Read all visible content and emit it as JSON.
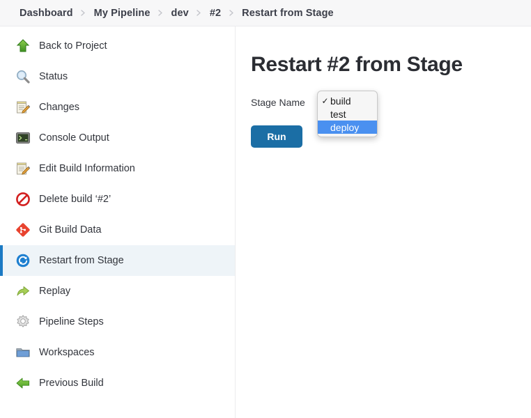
{
  "breadcrumb": {
    "items": [
      {
        "label": "Dashboard"
      },
      {
        "label": "My Pipeline"
      },
      {
        "label": "dev"
      },
      {
        "label": "#2"
      },
      {
        "label": "Restart from Stage"
      }
    ],
    "separator_icon": "chevron-right-icon"
  },
  "sidebar": {
    "items": [
      {
        "label": "Back to Project",
        "icon": "green-up-arrow-icon",
        "active": false
      },
      {
        "label": "Status",
        "icon": "magnifier-icon",
        "active": false
      },
      {
        "label": "Changes",
        "icon": "notepad-pencil-icon",
        "active": false
      },
      {
        "label": "Console Output",
        "icon": "terminal-icon",
        "active": false
      },
      {
        "label": "Edit Build Information",
        "icon": "notepad-pencil-icon",
        "active": false
      },
      {
        "label": "Delete build ‘#2’",
        "icon": "no-entry-icon",
        "active": false
      },
      {
        "label": "Git Build Data",
        "icon": "git-diamond-icon",
        "active": false
      },
      {
        "label": "Restart from Stage",
        "icon": "restart-circle-icon",
        "active": true
      },
      {
        "label": "Replay",
        "icon": "green-redo-arrow-icon",
        "active": false
      },
      {
        "label": "Pipeline Steps",
        "icon": "gear-icon",
        "active": false
      },
      {
        "label": "Workspaces",
        "icon": "folder-icon",
        "active": false
      },
      {
        "label": "Previous Build",
        "icon": "green-left-arrow-icon",
        "active": false
      }
    ]
  },
  "main": {
    "title": "Restart #2 from Stage",
    "stage_label": "Stage Name",
    "run_label": "Run",
    "stage_select": {
      "value": "build",
      "checked_option": "build",
      "highlighted_option": "deploy",
      "options": [
        {
          "label": "build",
          "checked": true,
          "highlighted": false
        },
        {
          "label": "test",
          "checked": false,
          "highlighted": false
        },
        {
          "label": "deploy",
          "checked": false,
          "highlighted": true
        }
      ]
    }
  },
  "colors": {
    "header_bg": "#f7f7f8",
    "accent_blue": "#1b7ac4",
    "run_button_bg": "#1b6ea5",
    "dropdown_highlight": "#4a90f0",
    "active_item_bg": "#eef4f8"
  }
}
